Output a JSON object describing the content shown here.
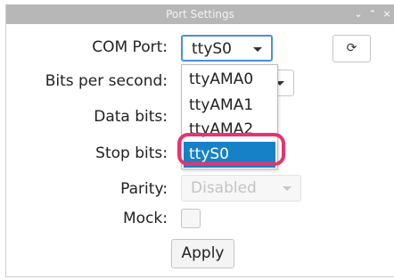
{
  "window": {
    "title": "Port Settings",
    "controls": {
      "minimize": "⌄",
      "maximize": "⌃",
      "close": "×"
    }
  },
  "form": {
    "com_port": {
      "label": "COM Port:",
      "value": "ttyS0"
    },
    "bits_per_second": {
      "label": "Bits per second:"
    },
    "data_bits": {
      "label": "Data bits:"
    },
    "stop_bits": {
      "label": "Stop bits:"
    },
    "parity": {
      "label": "Parity:",
      "value": "Disabled"
    },
    "mock": {
      "label": "Mock:",
      "checked": false
    },
    "refresh_icon": "⟳",
    "apply_label": "Apply"
  },
  "dropdown": {
    "options": [
      "ttyAMA0",
      "ttyAMA1",
      "ttyAMA2",
      "ttyS0"
    ],
    "selected": "ttyS0"
  },
  "colors": {
    "selection": "#1681c6",
    "highlight": "#e8336d",
    "focus_border": "#4a90d9"
  }
}
